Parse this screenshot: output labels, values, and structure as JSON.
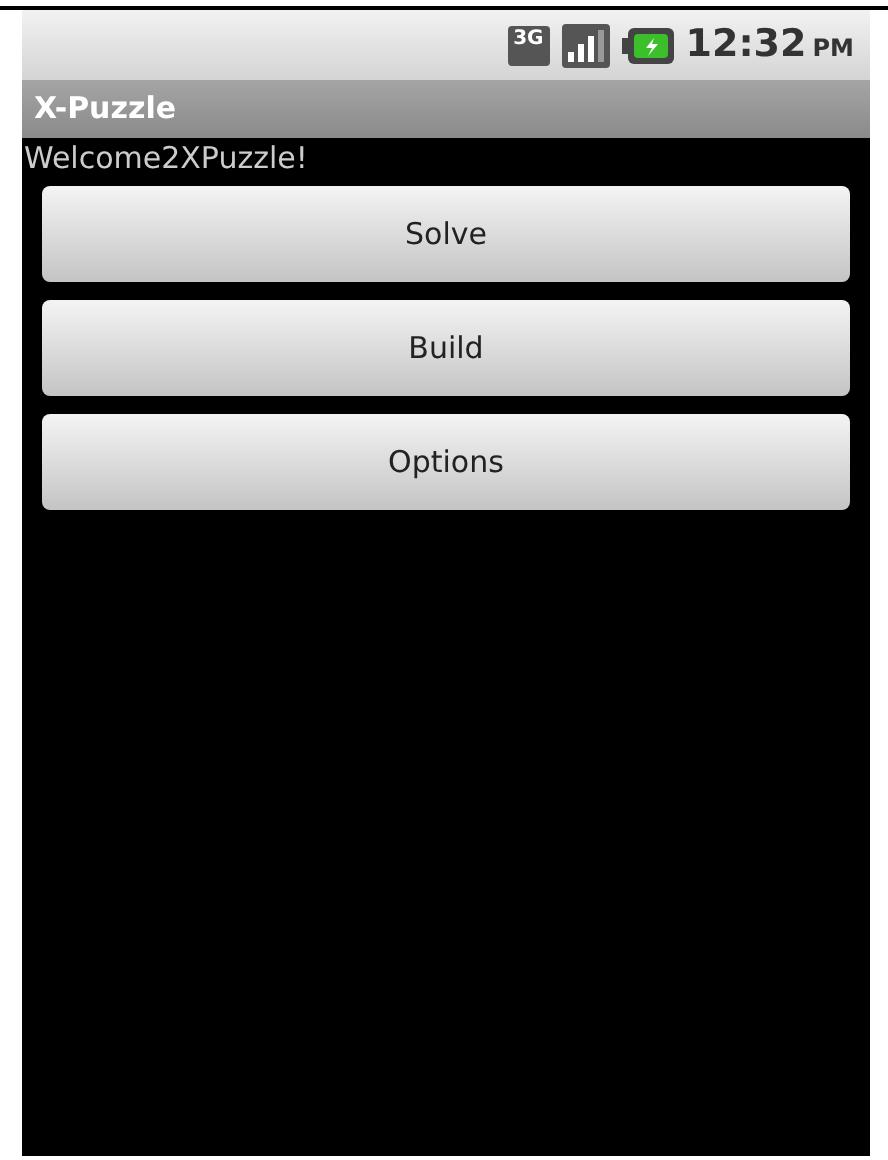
{
  "status_bar": {
    "network_type": "3G",
    "time": "12:32",
    "period": "PM"
  },
  "title_bar": {
    "title": "X-Puzzle"
  },
  "welcome": "Welcome2XPuzzle!",
  "buttons": [
    "Solve",
    "Build",
    "Options"
  ]
}
